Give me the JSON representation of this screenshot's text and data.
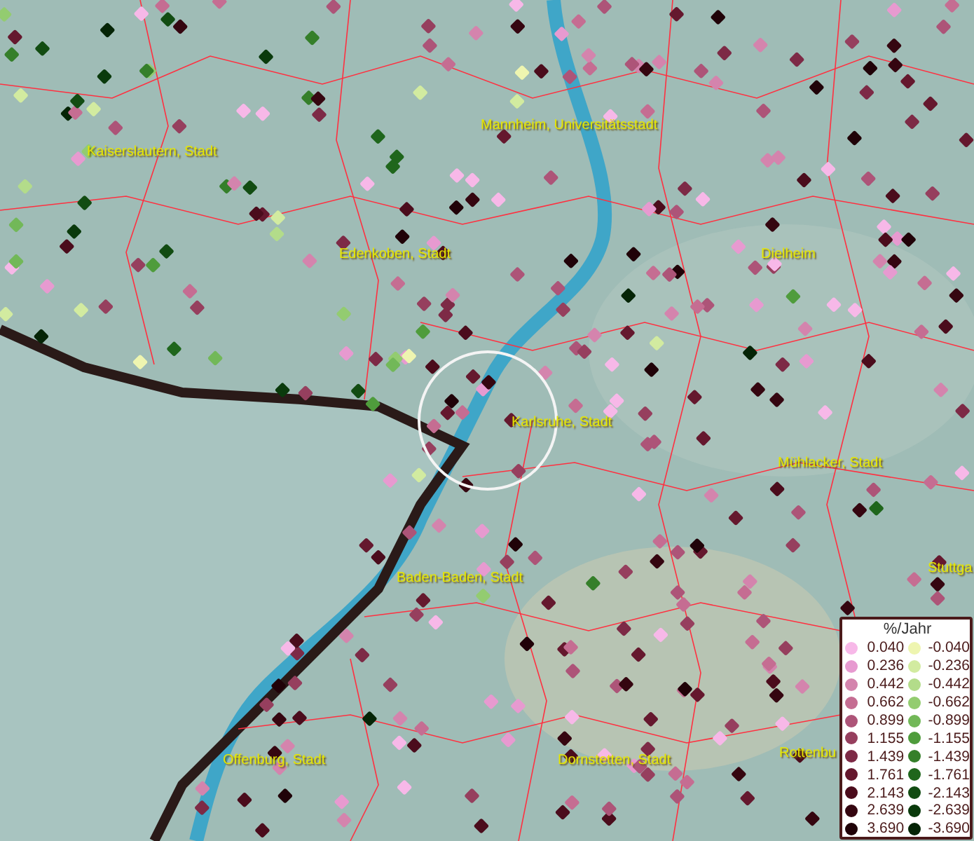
{
  "map": {
    "place_labels": [
      {
        "text": "Kaiserslautern, Stadt"
      },
      {
        "text": "Mannheim, Universitätsstadt"
      },
      {
        "text": "Edenkoben, Stadt"
      },
      {
        "text": "Dielheim"
      },
      {
        "text": "Karlsruhe, Stadt"
      },
      {
        "text": "Mühlacker, Stadt"
      },
      {
        "text": "Baden-Baden, Stadt"
      },
      {
        "text": "Stuttga"
      },
      {
        "text": "Offenburg, Stadt"
      },
      {
        "text": "Dornstetten, Stadt"
      },
      {
        "text": "Rottenbu"
      }
    ]
  },
  "legend": {
    "title": "%/Jahr",
    "rows": [
      {
        "positive": {
          "value": "0.040",
          "color": "#f7b8e8"
        },
        "negative": {
          "value": "-0.040",
          "color": "#eef5b0"
        }
      },
      {
        "positive": {
          "value": "0.236",
          "color": "#e79ad0"
        },
        "negative": {
          "value": "-0.236",
          "color": "#d2eba0"
        }
      },
      {
        "positive": {
          "value": "0.442",
          "color": "#d484ad"
        },
        "negative": {
          "value": "-0.442",
          "color": "#b3dc8a"
        }
      },
      {
        "positive": {
          "value": "0.662",
          "color": "#c56d92"
        },
        "negative": {
          "value": "-0.662",
          "color": "#93cc70"
        }
      },
      {
        "positive": {
          "value": "0.899",
          "color": "#ad5478"
        },
        "negative": {
          "value": "-0.899",
          "color": "#72b858"
        }
      },
      {
        "positive": {
          "value": "1.155",
          "color": "#963f5e"
        },
        "negative": {
          "value": "-1.155",
          "color": "#4f9c3c"
        }
      },
      {
        "positive": {
          "value": "1.439",
          "color": "#7d2a46"
        },
        "negative": {
          "value": "-1.439",
          "color": "#357f2a"
        }
      },
      {
        "positive": {
          "value": "1.761",
          "color": "#65182e"
        },
        "negative": {
          "value": "-1.761",
          "color": "#1f661c"
        }
      },
      {
        "positive": {
          "value": "2.143",
          "color": "#4b0c1c"
        },
        "negative": {
          "value": "-2.143",
          "color": "#124c12"
        }
      },
      {
        "positive": {
          "value": "2.639",
          "color": "#350610"
        },
        "negative": {
          "value": "-2.639",
          "color": "#0a3a0c"
        }
      },
      {
        "positive": {
          "value": "3.690",
          "color": "#200208"
        },
        "negative": {
          "value": "-3.690",
          "color": "#052406"
        }
      }
    ]
  }
}
